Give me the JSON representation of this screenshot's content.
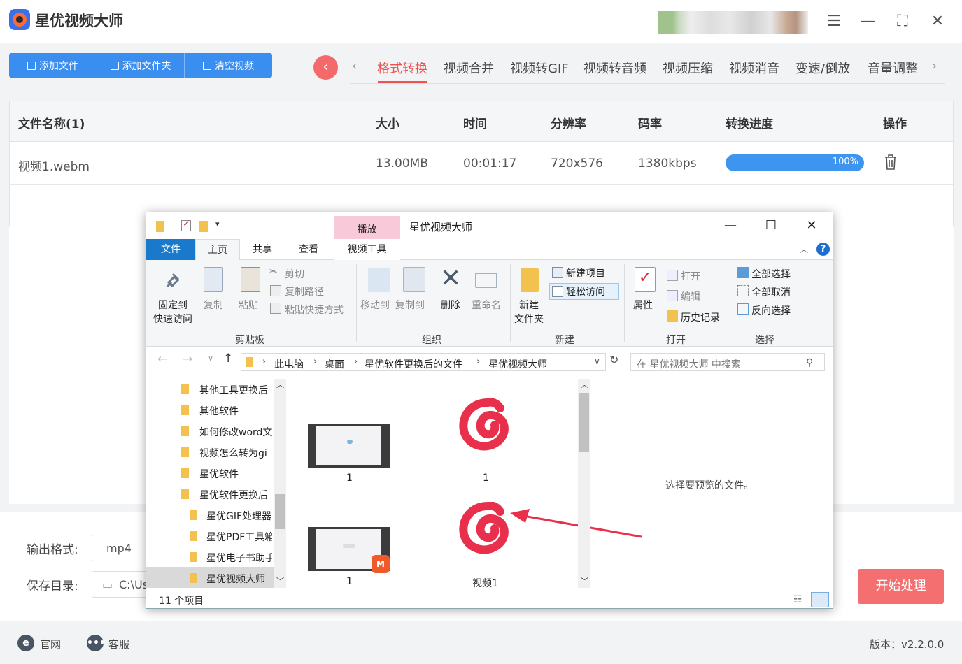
{
  "app": {
    "title": "星优视频大师",
    "window_buttons": [
      "menu-icon",
      "minimize-icon",
      "maximize-icon",
      "close-icon"
    ]
  },
  "toolbar": {
    "add_file": "添加文件",
    "add_folder": "添加文件夹",
    "clear": "清空视频"
  },
  "tabs": [
    "格式转换",
    "视频合并",
    "视频转GIF",
    "视频转音频",
    "视频压缩",
    "视频消音",
    "变速/倒放",
    "音量调整"
  ],
  "active_tab": "格式转换",
  "table": {
    "headers": [
      "文件名称(1)",
      "大小",
      "时间",
      "分辨率",
      "码率",
      "转换进度",
      "操作"
    ],
    "rows": [
      {
        "name": "视频1.webm",
        "size": "13.00MB",
        "time": "00:01:17",
        "resolution": "720x576",
        "bitrate": "1380kbps",
        "progress": "100%"
      }
    ]
  },
  "output": {
    "format_label": "输出格式:",
    "format_value": "mp4",
    "dir_label": "保存目录:",
    "dir_value": "C:\\Us"
  },
  "start_button": "开始处理",
  "footer": {
    "website": "官网",
    "support": "客服",
    "version": "版本：v2.2.0.0"
  },
  "explorer": {
    "title": "星优视频大师",
    "context_tab": "播放",
    "ribbon_tabs": [
      "文件",
      "主页",
      "共享",
      "查看",
      "视频工具"
    ],
    "ribbon": {
      "pin": [
        "固定到",
        "快速访问"
      ],
      "copy": "复制",
      "paste": "粘贴",
      "cut": "剪切",
      "copy_path": "复制路径",
      "paste_shortcut": "粘贴快捷方式",
      "clipboard": "剪贴板",
      "move_to": "移动到",
      "copy_to": "复制到",
      "delete": "删除",
      "rename": "重命名",
      "organize": "组织",
      "new_folder": [
        "新建",
        "文件夹"
      ],
      "new_item": "新建项目",
      "easy_access": "轻松访问",
      "new": "新建",
      "properties": "属性",
      "open": "打开",
      "edit": "编辑",
      "history": "历史记录",
      "open_group": "打开",
      "select_all": "全部选择",
      "select_none": "全部取消",
      "invert": "反向选择",
      "select": "选择"
    },
    "breadcrumb": [
      "此电脑",
      "桌面",
      "星优软件更换后的文件",
      "星优视频大师"
    ],
    "search_placeholder": "在 星优视频大师 中搜索",
    "tree": [
      "其他工具更换后",
      "其他软件",
      "如何修改word文",
      "视频怎么转为gi",
      "星优软件",
      "星优软件更换后",
      "星优GIF处理器",
      "星优PDF工具箱",
      "星优电子书助手",
      "星优视频大师"
    ],
    "files": [
      {
        "label": "1",
        "type": "video"
      },
      {
        "label": "1",
        "type": "netease"
      },
      {
        "label": "1",
        "type": "video"
      },
      {
        "label": "视频1",
        "type": "netease"
      }
    ],
    "preview_text": "选择要预览的文件。",
    "status": "11 个项目"
  },
  "colors": {
    "accent": "#3a8ef0",
    "active_tab": "#f0524f",
    "start": "#f46f6f",
    "netease": "#e8304c"
  }
}
